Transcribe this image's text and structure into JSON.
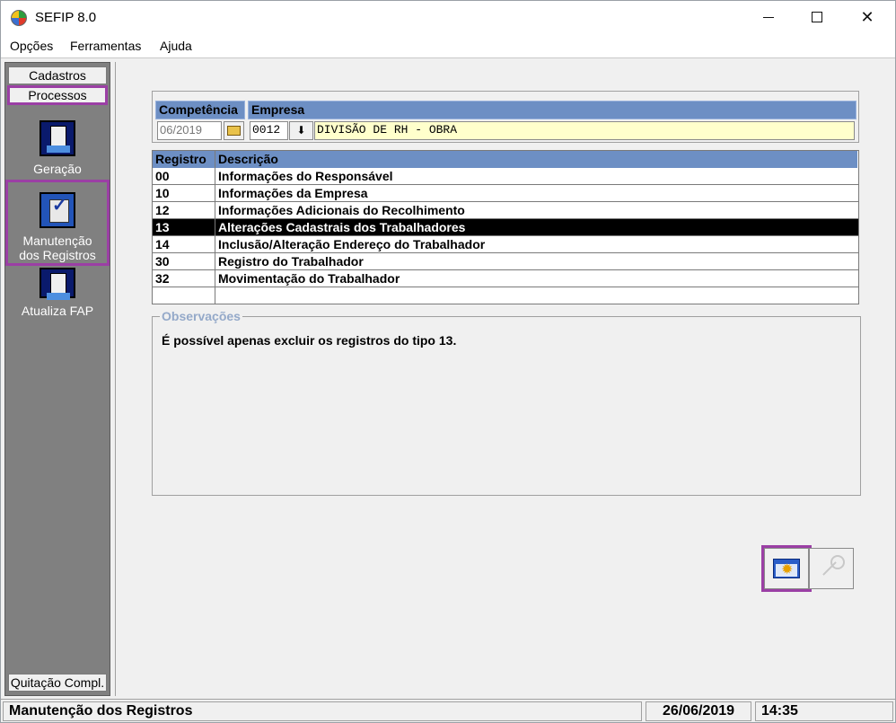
{
  "window": {
    "title": "SEFIP 8.0"
  },
  "menu": [
    {
      "label": "Opções"
    },
    {
      "label": "Ferramentas"
    },
    {
      "label": "Ajuda"
    }
  ],
  "nav": {
    "tabs": [
      {
        "label": "Cadastros"
      },
      {
        "label": "Processos"
      }
    ],
    "items": [
      {
        "label": "Geração",
        "icon": "disk-generation-icon"
      },
      {
        "label": "Manutenção dos Registros",
        "icon": "maintenance-check-icon"
      },
      {
        "label": "Atualiza FAP",
        "icon": "disk-update-icon"
      }
    ],
    "bottom_tab": "Quitação Compl."
  },
  "competencia": {
    "header_comp": "Competência",
    "header_empresa": "Empresa",
    "date_value": "06/2019",
    "code_value": "0012",
    "company_name": "DIVISÃO DE RH - OBRA"
  },
  "grid": {
    "headers": {
      "code": "Registro",
      "desc": "Descrição"
    },
    "rows": [
      {
        "code": "00",
        "desc": "Informações do Responsável"
      },
      {
        "code": "10",
        "desc": "Informações da Empresa"
      },
      {
        "code": "12",
        "desc": "Informações Adicionais do Recolhimento"
      },
      {
        "code": "13",
        "desc": "Alterações Cadastrais dos Trabalhadores"
      },
      {
        "code": "14",
        "desc": "Inclusão/Alteração Endereço do Trabalhador"
      },
      {
        "code": "30",
        "desc": "Registro do Trabalhador"
      },
      {
        "code": "32",
        "desc": "Movimentação do Trabalhador"
      }
    ],
    "selected_index": 3
  },
  "observacoes": {
    "legend": "Observações",
    "text": "É possível  apenas excluir os registros do tipo 13."
  },
  "status": {
    "label": "Manutenção dos Registros",
    "date": "26/06/2019",
    "time": "14:35"
  },
  "colors": {
    "highlight": "#9b3fa5",
    "grid_header": "#6d8fc4",
    "selected_row": "#000000"
  }
}
